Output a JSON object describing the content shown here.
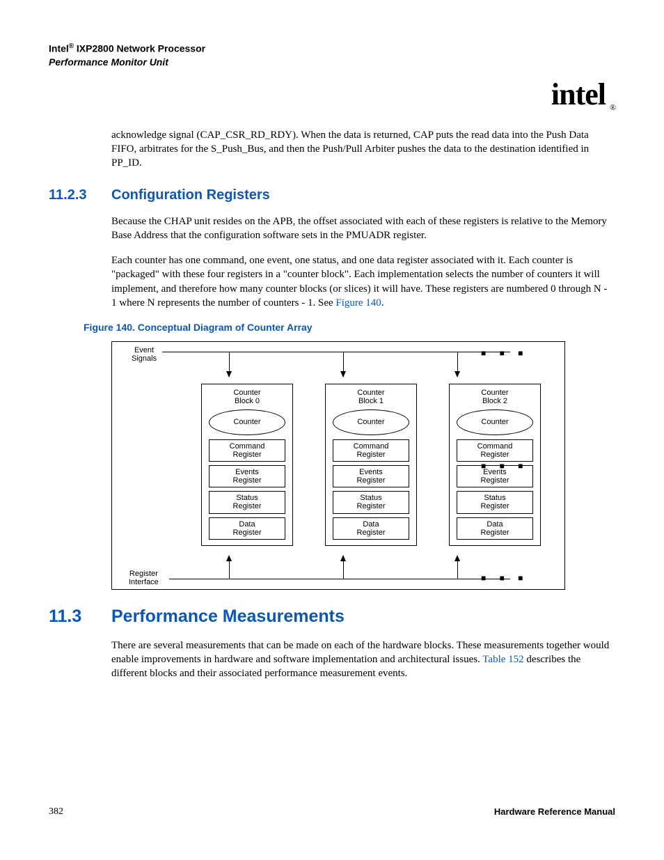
{
  "header": {
    "line1_pre": "Intel",
    "line1_sup": "®",
    "line1_post": " IXP2800 Network Processor",
    "line2": "Performance Monitor Unit"
  },
  "logo": {
    "text": "intel",
    "reg": "®"
  },
  "intro_para": "acknowledge signal (CAP_CSR_RD_RDY). When the data is returned, CAP puts the read data into the Push Data FIFO, arbitrates for the S_Push_Bus, and then the Push/Pull Arbiter pushes the data to the destination identified in PP_ID.",
  "sec1": {
    "num": "11.2.3",
    "title": "Configuration Registers"
  },
  "para1": "Because the CHAP unit resides on the APB, the offset associated with each of these registers is relative to the Memory Base Address that the configuration software sets in the PMUADR register.",
  "para2_pre": "Each counter has one command, one event, one status, and one data register associated with it. Each counter is \"packaged\" with these four registers in a \"counter block\". Each implementation selects the number of counters it will implement, and therefore how many counter blocks (or slices) it will have. These registers are numbered 0 through N - 1 where N represents the number of counters - 1. See ",
  "para2_link": "Figure 140",
  "para2_post": ".",
  "fig_caption": "Figure 140. Conceptual Diagram of Counter Array",
  "diagram": {
    "event_label_l1": "Event",
    "event_label_l2": "Signals",
    "reg_if_l1": "Register",
    "reg_if_l2": "Interface",
    "blocks": [
      {
        "title_l1": "Counter",
        "title_l2": "Block 0"
      },
      {
        "title_l1": "Counter",
        "title_l2": "Block 1"
      },
      {
        "title_l1": "Counter",
        "title_l2": "Block 2"
      }
    ],
    "oval": "Counter",
    "regs": [
      {
        "l1": "Command",
        "l2": "Register"
      },
      {
        "l1": "Events",
        "l2": "Register"
      },
      {
        "l1": "Status",
        "l2": "Register"
      },
      {
        "l1": "Data",
        "l2": "Register"
      }
    ]
  },
  "sec2": {
    "num": "11.3",
    "title": "Performance Measurements"
  },
  "para3_pre": "There are several measurements that can be made on each of the hardware blocks. These measurements together would enable improvements in hardware and software implementation and architectural issues. ",
  "para3_link": "Table 152",
  "para3_post": " describes the different blocks and their associated performance measurement events.",
  "footer": {
    "page": "382",
    "doc": "Hardware Reference Manual"
  }
}
